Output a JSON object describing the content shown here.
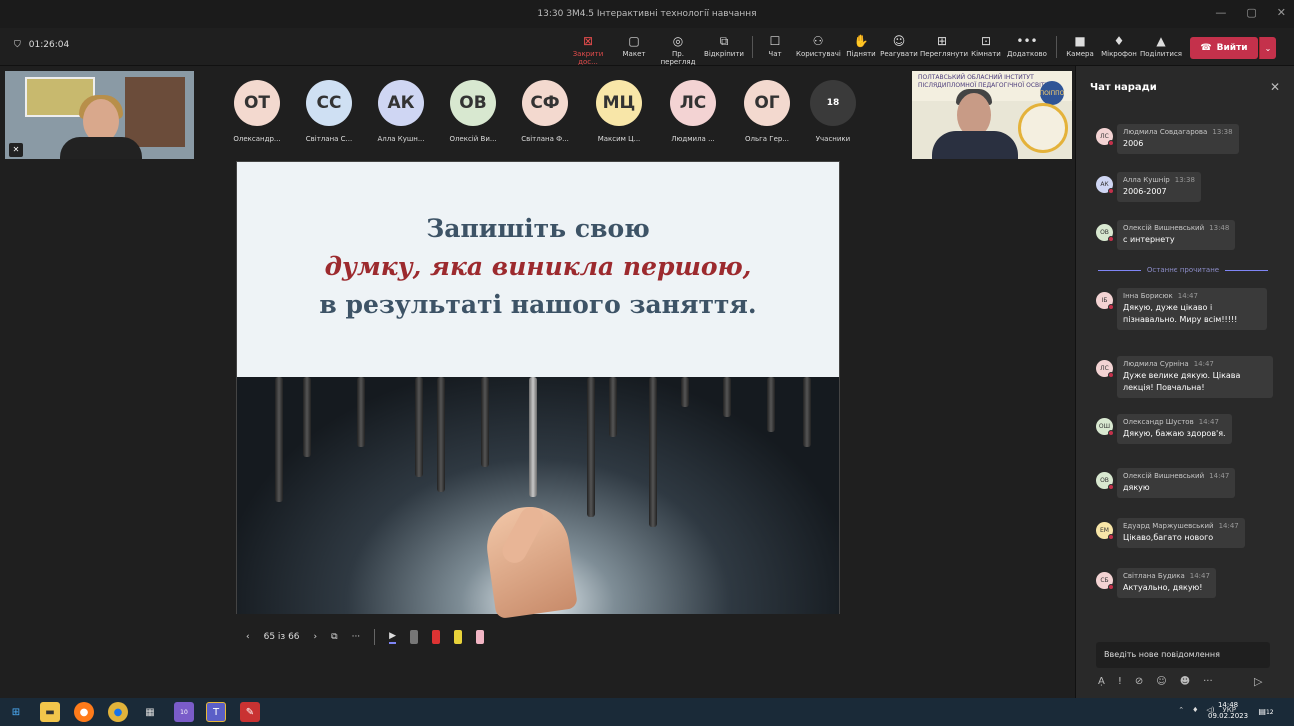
{
  "window": {
    "title": "13:30 ЗМ4.5 Інтерактивні технології навчання",
    "min": "—",
    "max": "▢",
    "close": "✕"
  },
  "toolbar": {
    "timer": "01:26:04",
    "buttons": [
      {
        "label": "Закрити дос...",
        "icon": "⊠"
      },
      {
        "label": "Макет",
        "icon": "▢"
      },
      {
        "label": "Пр. перегляд",
        "icon": "◎"
      },
      {
        "label": "Відкріпити",
        "icon": "⧉"
      },
      {
        "label": "Чат",
        "icon": "☐"
      },
      {
        "label": "Користувачі",
        "icon": "⚇"
      },
      {
        "label": "Підняти",
        "icon": "✋"
      },
      {
        "label": "Реагувати",
        "icon": "☺"
      },
      {
        "label": "Переглянути",
        "icon": "⊞"
      },
      {
        "label": "Кімнати",
        "icon": "⊡"
      },
      {
        "label": "Додатково",
        "icon": "•••"
      },
      {
        "label": "Камера",
        "icon": "■"
      },
      {
        "label": "Мікрофон",
        "icon": "♦"
      },
      {
        "label": "Поділитися",
        "icon": "▲"
      }
    ],
    "leave_label": "Вийти",
    "leave_icon": "☎"
  },
  "participants": [
    {
      "initials": "ОТ",
      "name": "Олександр...",
      "color": "#f3d9cf"
    },
    {
      "initials": "СС",
      "name": "Світлана С...",
      "color": "#cfe0f3"
    },
    {
      "initials": "АК",
      "name": "Алла Кушн...",
      "color": "#cfd6f3"
    },
    {
      "initials": "ОВ",
      "name": "Олексій Ви...",
      "color": "#d8e8d0"
    },
    {
      "initials": "СФ",
      "name": "Світлана Ф...",
      "color": "#f3d9cf"
    },
    {
      "initials": "МЦ",
      "name": "Максим Ц...",
      "color": "#f8e6a8"
    },
    {
      "initials": "ЛС",
      "name": "Людмила ...",
      "color": "#f3d3d3"
    },
    {
      "initials": "ОГ",
      "name": "Ольга Гер...",
      "color": "#f3d9cf"
    },
    {
      "initials": "18",
      "name": "Учасники",
      "color": "#3a3a3a"
    }
  ],
  "speaker_banner": "ПОЛТАВСЬКИЙ ОБЛАСНИЙ ІНСТИТУТ ПІСЛЯДИПЛОМНОЇ ПЕДАГОГІЧНОЇ ОСВІТИ",
  "speaker_logo": "ПОІППО",
  "slide": {
    "line1": "Запишіть свою",
    "line2": "думку, яка виникла першою,",
    "line3": "в результаті нашого заняття."
  },
  "slide_controls": {
    "prev": "‹",
    "page": "65 із 66",
    "next": "›",
    "grid": "⧉",
    "more": "···",
    "pointer": "▶"
  },
  "chat": {
    "title": "Чат наради",
    "close": "✕",
    "last_read": "Останнє прочитане",
    "messages": [
      {
        "initials": "ЛС",
        "author": "Людмила Совдагарова",
        "time": "13:38",
        "text": "2006",
        "color": "#f3d3d3"
      },
      {
        "initials": "АК",
        "author": "Алла Кушнір",
        "time": "13:38",
        "text": "2006-2007",
        "color": "#cfd6f3"
      },
      {
        "initials": "ОВ",
        "author": "Олексій Вишневський",
        "time": "13:48",
        "text": "с интернету",
        "color": "#d8e8d0"
      },
      {
        "initials": "ІБ",
        "author": "Інна Борисюк",
        "time": "14:47",
        "text": "Дякую, дуже цікаво і пізнавально. Миру всім!!!!!",
        "color": "#f3d3d3"
      },
      {
        "initials": "ЛС",
        "author": "Людмила Сурніна",
        "time": "14:47",
        "text": "Дуже велике дякую. Цікава лекція! Повчальна!",
        "color": "#f3d3d3"
      },
      {
        "initials": "ОШ",
        "author": "Олександр Шустов",
        "time": "14:47",
        "text": "Дякую, бажаю здоров'я.",
        "color": "#d8e8d0"
      },
      {
        "initials": "ОВ",
        "author": "Олексій Вишневський",
        "time": "14:47",
        "text": "дякую",
        "color": "#d8e8d0"
      },
      {
        "initials": "ЕМ",
        "author": "Едуард Маржушевський",
        "time": "14:47",
        "text": "Цікаво,багато нового",
        "color": "#f8e6a8"
      },
      {
        "initials": "СБ",
        "author": "Світлана Будика",
        "time": "14:47",
        "text": "Актуально, дякую!",
        "color": "#f3d3d3"
      }
    ],
    "input_placeholder": "Введіть нове повідомлення",
    "icons": [
      "Ạ",
      "!",
      "⊘",
      "☺",
      "☻",
      "···"
    ],
    "send": "▷"
  },
  "taskbar": {
    "lang": "УКР",
    "time": "14:48",
    "date": "09.02.2023",
    "notifications": "12",
    "viber_badge": "10"
  }
}
